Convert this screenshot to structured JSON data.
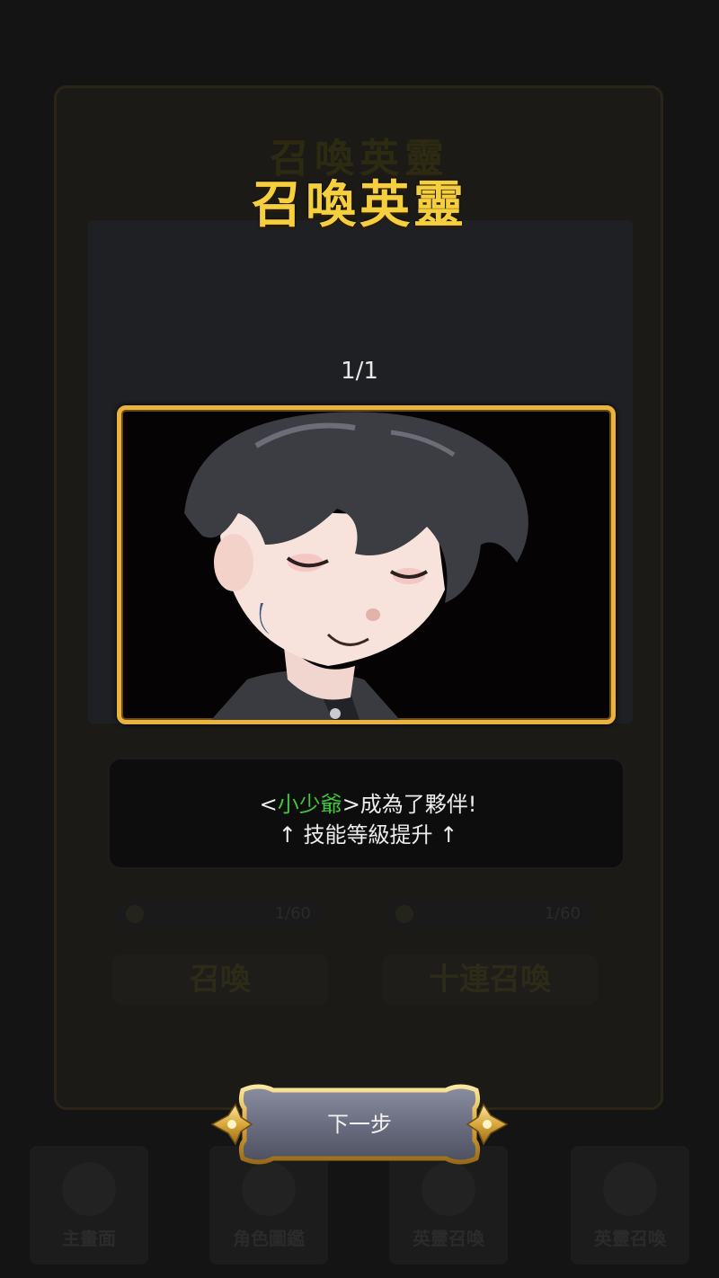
{
  "background": {
    "title": "召喚英靈",
    "cost_left": "1/60",
    "cost_right": "1/60",
    "summon_button": "召喚",
    "ten_summon_button": "十連召喚",
    "nav": [
      "主畫面",
      "角色圖鑑",
      "英靈召喚",
      "英靈召喚"
    ]
  },
  "dialog": {
    "title": "召喚英靈",
    "counter": "1/1",
    "message_prefix": "<",
    "hero_name": "小少爺",
    "message_suffix": ">成為了夥伴!",
    "message_line2": "↑ 技能等級提升 ↑",
    "next_button": "下一步"
  },
  "colors": {
    "title_gold": "#f6cf3e",
    "frame_gold": "#e9b33d",
    "hero_name_green": "#3ec83a",
    "button_steel": "#6b6e80"
  }
}
